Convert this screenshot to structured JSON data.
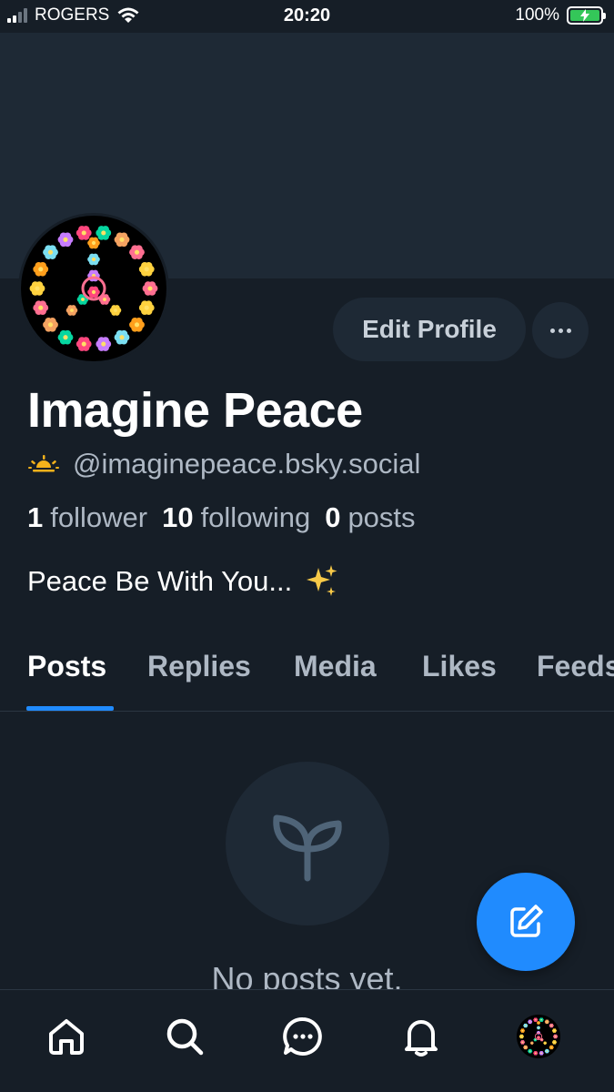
{
  "status_bar": {
    "carrier": "ROGERS",
    "time": "20:20",
    "battery": "100%",
    "battery_level": 1.0,
    "battery_color": "#34c759"
  },
  "profile": {
    "display_name": "Imagine Peace",
    "handle": "@imaginepeace.bsky.social",
    "handle_icon": "sunrise-icon",
    "bio_text": "Peace Be With You...",
    "bio_emoji_icon": "sparkles-icon",
    "avatar_icon": "peace-sign-flowers-avatar"
  },
  "actions": {
    "edit_profile_label": "Edit Profile",
    "more_icon": "ellipsis-icon"
  },
  "stats": {
    "followers_count": "1",
    "followers_label": "follower",
    "following_count": "10",
    "following_label": "following",
    "posts_count": "0",
    "posts_label": "posts"
  },
  "tabs": [
    {
      "label": "Posts",
      "active": true
    },
    {
      "label": "Replies",
      "active": false
    },
    {
      "label": "Media",
      "active": false
    },
    {
      "label": "Likes",
      "active": false
    },
    {
      "label": "Feeds",
      "active": false
    }
  ],
  "empty_state": {
    "icon": "seedling-icon",
    "text": "No posts yet."
  },
  "fab": {
    "icon": "compose-icon"
  },
  "bottom_nav": [
    {
      "icon": "home-icon"
    },
    {
      "icon": "search-icon"
    },
    {
      "icon": "chat-icon"
    },
    {
      "icon": "bell-icon"
    },
    {
      "icon": "profile-avatar"
    }
  ],
  "colors": {
    "background": "#161e27",
    "surface": "#1e2935",
    "accent": "#208bfe",
    "text_secondary": "#aeb8c4"
  }
}
